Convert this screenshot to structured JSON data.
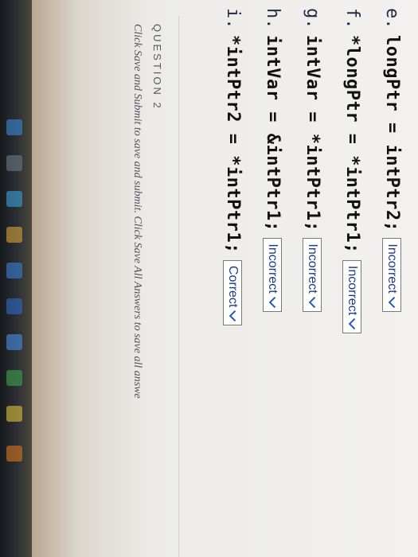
{
  "lines": [
    {
      "letter": "e.",
      "code": "longPtr  =  intPtr2;",
      "answer": "Incorrect"
    },
    {
      "letter": "f.",
      "code": "*longPtr  =  *intPtr1;",
      "answer": "Incorrect"
    },
    {
      "letter": "g.",
      "code": "intVar  =  *intPtr1;",
      "answer": "Incorrect"
    },
    {
      "letter": "h.",
      "code": "intVar  =  &intPtr1;",
      "answer": "Incorrect"
    },
    {
      "letter": "i.",
      "code": "*intPtr2  =  *intPtr1;",
      "answer": "Correct"
    }
  ],
  "question": {
    "label": "QUESTION 2",
    "instructions": "Click Save and Submit to save and submit. Click Save All Answers to save all answe"
  },
  "colors": {
    "select_text": "#1e3a8a",
    "chevron": "#2b5cb8"
  }
}
